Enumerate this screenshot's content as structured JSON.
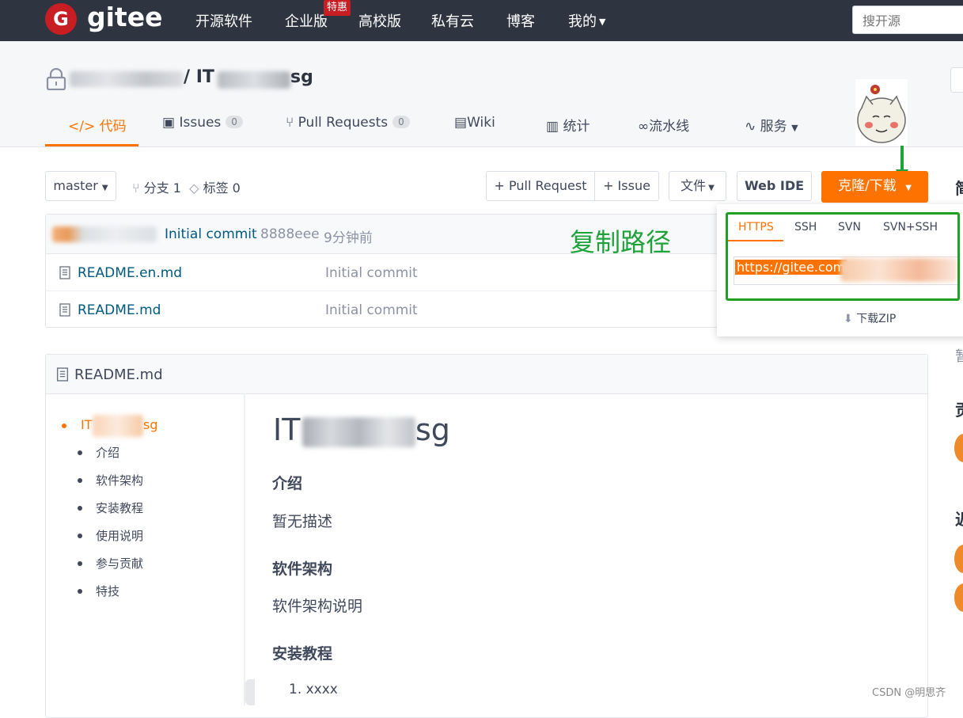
{
  "nav": {
    "logo_letter": "G",
    "logo_text": "gitee",
    "links": [
      "开源软件",
      "企业版",
      "高校版",
      "私有云",
      "博客",
      "我的"
    ],
    "badge": "特惠",
    "search_placeholder": "搜开源"
  },
  "repo": {
    "title_suffix": "/ IT",
    "title_end": "sg",
    "tabs": {
      "code": "代码",
      "issues": "Issues",
      "issues_count": "0",
      "pull_requests": "Pull Requests",
      "pr_count": "0",
      "wiki": "Wiki",
      "stats": "统计",
      "pipeline": "流水线",
      "services": "服务"
    }
  },
  "toolbar": {
    "branch": "master",
    "branches_label": "分支 1",
    "tags_label": "标签 0",
    "pull_request": "+ Pull Request",
    "issue": "+ Issue",
    "file": "文件",
    "web_ide": "Web IDE",
    "clone": "克隆/下载"
  },
  "commit": {
    "message": "Initial commit",
    "hash": "8888eee",
    "time": "9分钟前"
  },
  "annotation": "复制路径",
  "files": [
    {
      "name": "README.en.md",
      "commit": "Initial commit"
    },
    {
      "name": "README.md",
      "commit": "Initial commit"
    }
  ],
  "clone_popup": {
    "tabs": [
      "HTTPS",
      "SSH",
      "SVN",
      "SVN+SSH"
    ],
    "url": "https://gitee.com",
    "download_zip": "下载ZIP"
  },
  "readme": {
    "title": "README.md",
    "toc_root_start": "IT",
    "toc_root_end": "sg",
    "toc": [
      "介绍",
      "软件架构",
      "安装教程",
      "使用说明",
      "参与贡献",
      "特技"
    ],
    "h1_start": "IT",
    "h1_end": "sg",
    "sections": [
      {
        "heading": "介绍",
        "text": "暂无描述"
      },
      {
        "heading": "软件架构",
        "text": "软件架构说明"
      },
      {
        "heading": "安装教程",
        "text": ""
      }
    ],
    "list_item": "1. xxxx"
  },
  "side_chars": [
    "简",
    "暂",
    "贡",
    "近"
  ],
  "watermark": "CSDN @明思齐",
  "colors": {
    "accent": "#fe7300",
    "nav_bg": "#2f3540",
    "brand_red": "#c71d23",
    "annotation_green": "#1fa23a",
    "link": "#005980"
  }
}
